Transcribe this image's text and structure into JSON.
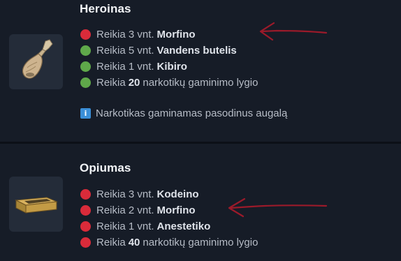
{
  "heroinas": {
    "title": "Heroinas",
    "requirements": [
      {
        "status": "red",
        "prefix": "Reikia 3 vnt.",
        "bold": "Morfino",
        "suffix": ""
      },
      {
        "status": "green",
        "prefix": "Reikia 5 vnt.",
        "bold": "Vandens butelis",
        "suffix": ""
      },
      {
        "status": "green",
        "prefix": "Reikia 1 vnt.",
        "bold": "Kibiro",
        "suffix": ""
      },
      {
        "status": "green",
        "prefix": "Reikia",
        "bold": "20",
        "suffix": "narkotikų gaminimo lygio"
      }
    ],
    "note_icon": "i",
    "note": "Narkotikas gaminamas pasodinus augalą",
    "thumbnail_icon": "heroin-bag-icon"
  },
  "opiumas": {
    "title": "Opiumas",
    "requirements": [
      {
        "status": "red",
        "prefix": "Reikia 3 vnt.",
        "bold": "Kodeino",
        "suffix": ""
      },
      {
        "status": "red",
        "prefix": "Reikia 2 vnt.",
        "bold": "Morfino",
        "suffix": ""
      },
      {
        "status": "red",
        "prefix": "Reikia 1 vnt.",
        "bold": "Anestetiko",
        "suffix": ""
      },
      {
        "status": "red",
        "prefix": "Reikia",
        "bold": "40",
        "suffix": "narkotikų gaminimo lygio"
      }
    ],
    "thumbnail_icon": "opium-block-icon"
  },
  "colors": {
    "missing": "#d92b3a",
    "met": "#5fa84a",
    "info": "#3b8fd8",
    "annotation_arrow": "#9b1a2a"
  }
}
